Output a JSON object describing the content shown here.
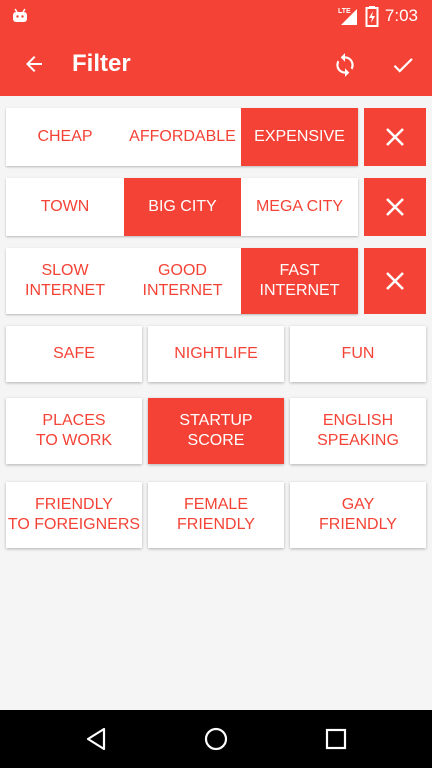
{
  "status_bar": {
    "time": "7:03",
    "network": "LTE"
  },
  "app_bar": {
    "title": "Filter",
    "back_icon": "arrow-back-icon",
    "refresh_icon": "refresh-icon",
    "done_icon": "check-icon"
  },
  "colors": {
    "accent": "#f44336",
    "background": "#f5f5f5",
    "tile": "#ffffff"
  },
  "filters": {
    "price": {
      "options": [
        "CHEAP",
        "AFFORDABLE",
        "EXPENSIVE"
      ],
      "selected": "EXPENSIVE"
    },
    "size": {
      "options": [
        "TOWN",
        "BIG CITY",
        "MEGA CITY"
      ],
      "selected": "BIG CITY"
    },
    "internet": {
      "options": [
        "SLOW\nINTERNET",
        "GOOD\nINTERNET",
        "FAST\nINTERNET"
      ],
      "selected": "FAST\nINTERNET"
    },
    "row4": [
      "SAFE",
      "NIGHTLIFE",
      "FUN"
    ],
    "row5": [
      "PLACES\nTO WORK",
      "STARTUP\nSCORE",
      "ENGLISH\nSPEAKING"
    ],
    "row5_selected": "STARTUP\nSCORE",
    "row6": [
      "FRIENDLY\nTO FOREIGNERS",
      "FEMALE\nFRIENDLY",
      "GAY\nFRIENDLY"
    ]
  }
}
